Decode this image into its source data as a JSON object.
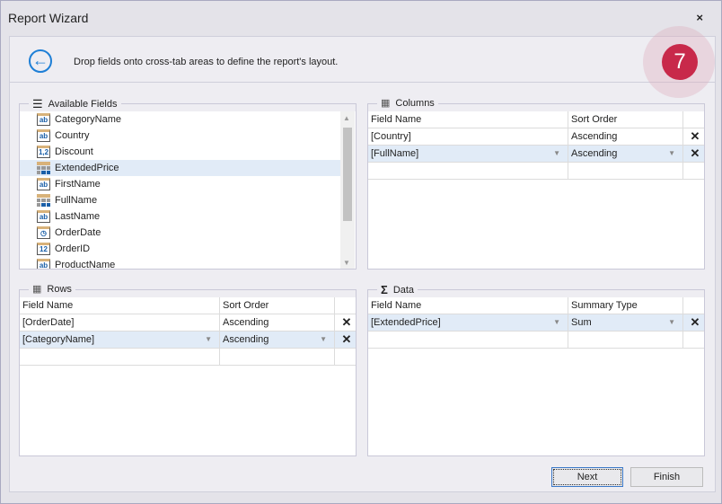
{
  "window": {
    "title": "Report Wizard",
    "close": "×"
  },
  "header": {
    "description": "Drop fields onto cross-tab areas to define the report's layout.",
    "step": "7",
    "back_icon": "arrow-left-circle-icon"
  },
  "available": {
    "title": "Available Fields",
    "items": [
      {
        "label": "CategoryName",
        "icon": "ab"
      },
      {
        "label": "Country",
        "icon": "ab"
      },
      {
        "label": "Discount",
        "icon": "1,2"
      },
      {
        "label": "ExtendedPrice",
        "icon": "calc",
        "selected": true
      },
      {
        "label": "FirstName",
        "icon": "ab"
      },
      {
        "label": "FullName",
        "icon": "calc"
      },
      {
        "label": "LastName",
        "icon": "ab"
      },
      {
        "label": "OrderDate",
        "icon": "clock"
      },
      {
        "label": "OrderID",
        "icon": "12"
      },
      {
        "label": "ProductName",
        "icon": "ab"
      }
    ]
  },
  "columns": {
    "title": "Columns",
    "headers": [
      "Field Name",
      "Sort Order"
    ],
    "rows": [
      {
        "field": "[Country]",
        "order": "Ascending"
      },
      {
        "field": "[FullName]",
        "order": "Ascending"
      }
    ]
  },
  "rows": {
    "title": "Rows",
    "headers": [
      "Field Name",
      "Sort Order"
    ],
    "rows": [
      {
        "field": "[OrderDate]",
        "order": "Ascending"
      },
      {
        "field": "[CategoryName]",
        "order": "Ascending"
      }
    ]
  },
  "data": {
    "title": "Data",
    "headers": [
      "Field Name",
      "Summary Type"
    ],
    "rows": [
      {
        "field": "[ExtendedPrice]",
        "order": "Sum"
      }
    ]
  },
  "buttons": {
    "next": "Next",
    "finish": "Finish"
  },
  "colors": {
    "accent": "#1e7fd6",
    "step": "#c8294a",
    "selection": "#e1ebf7"
  }
}
